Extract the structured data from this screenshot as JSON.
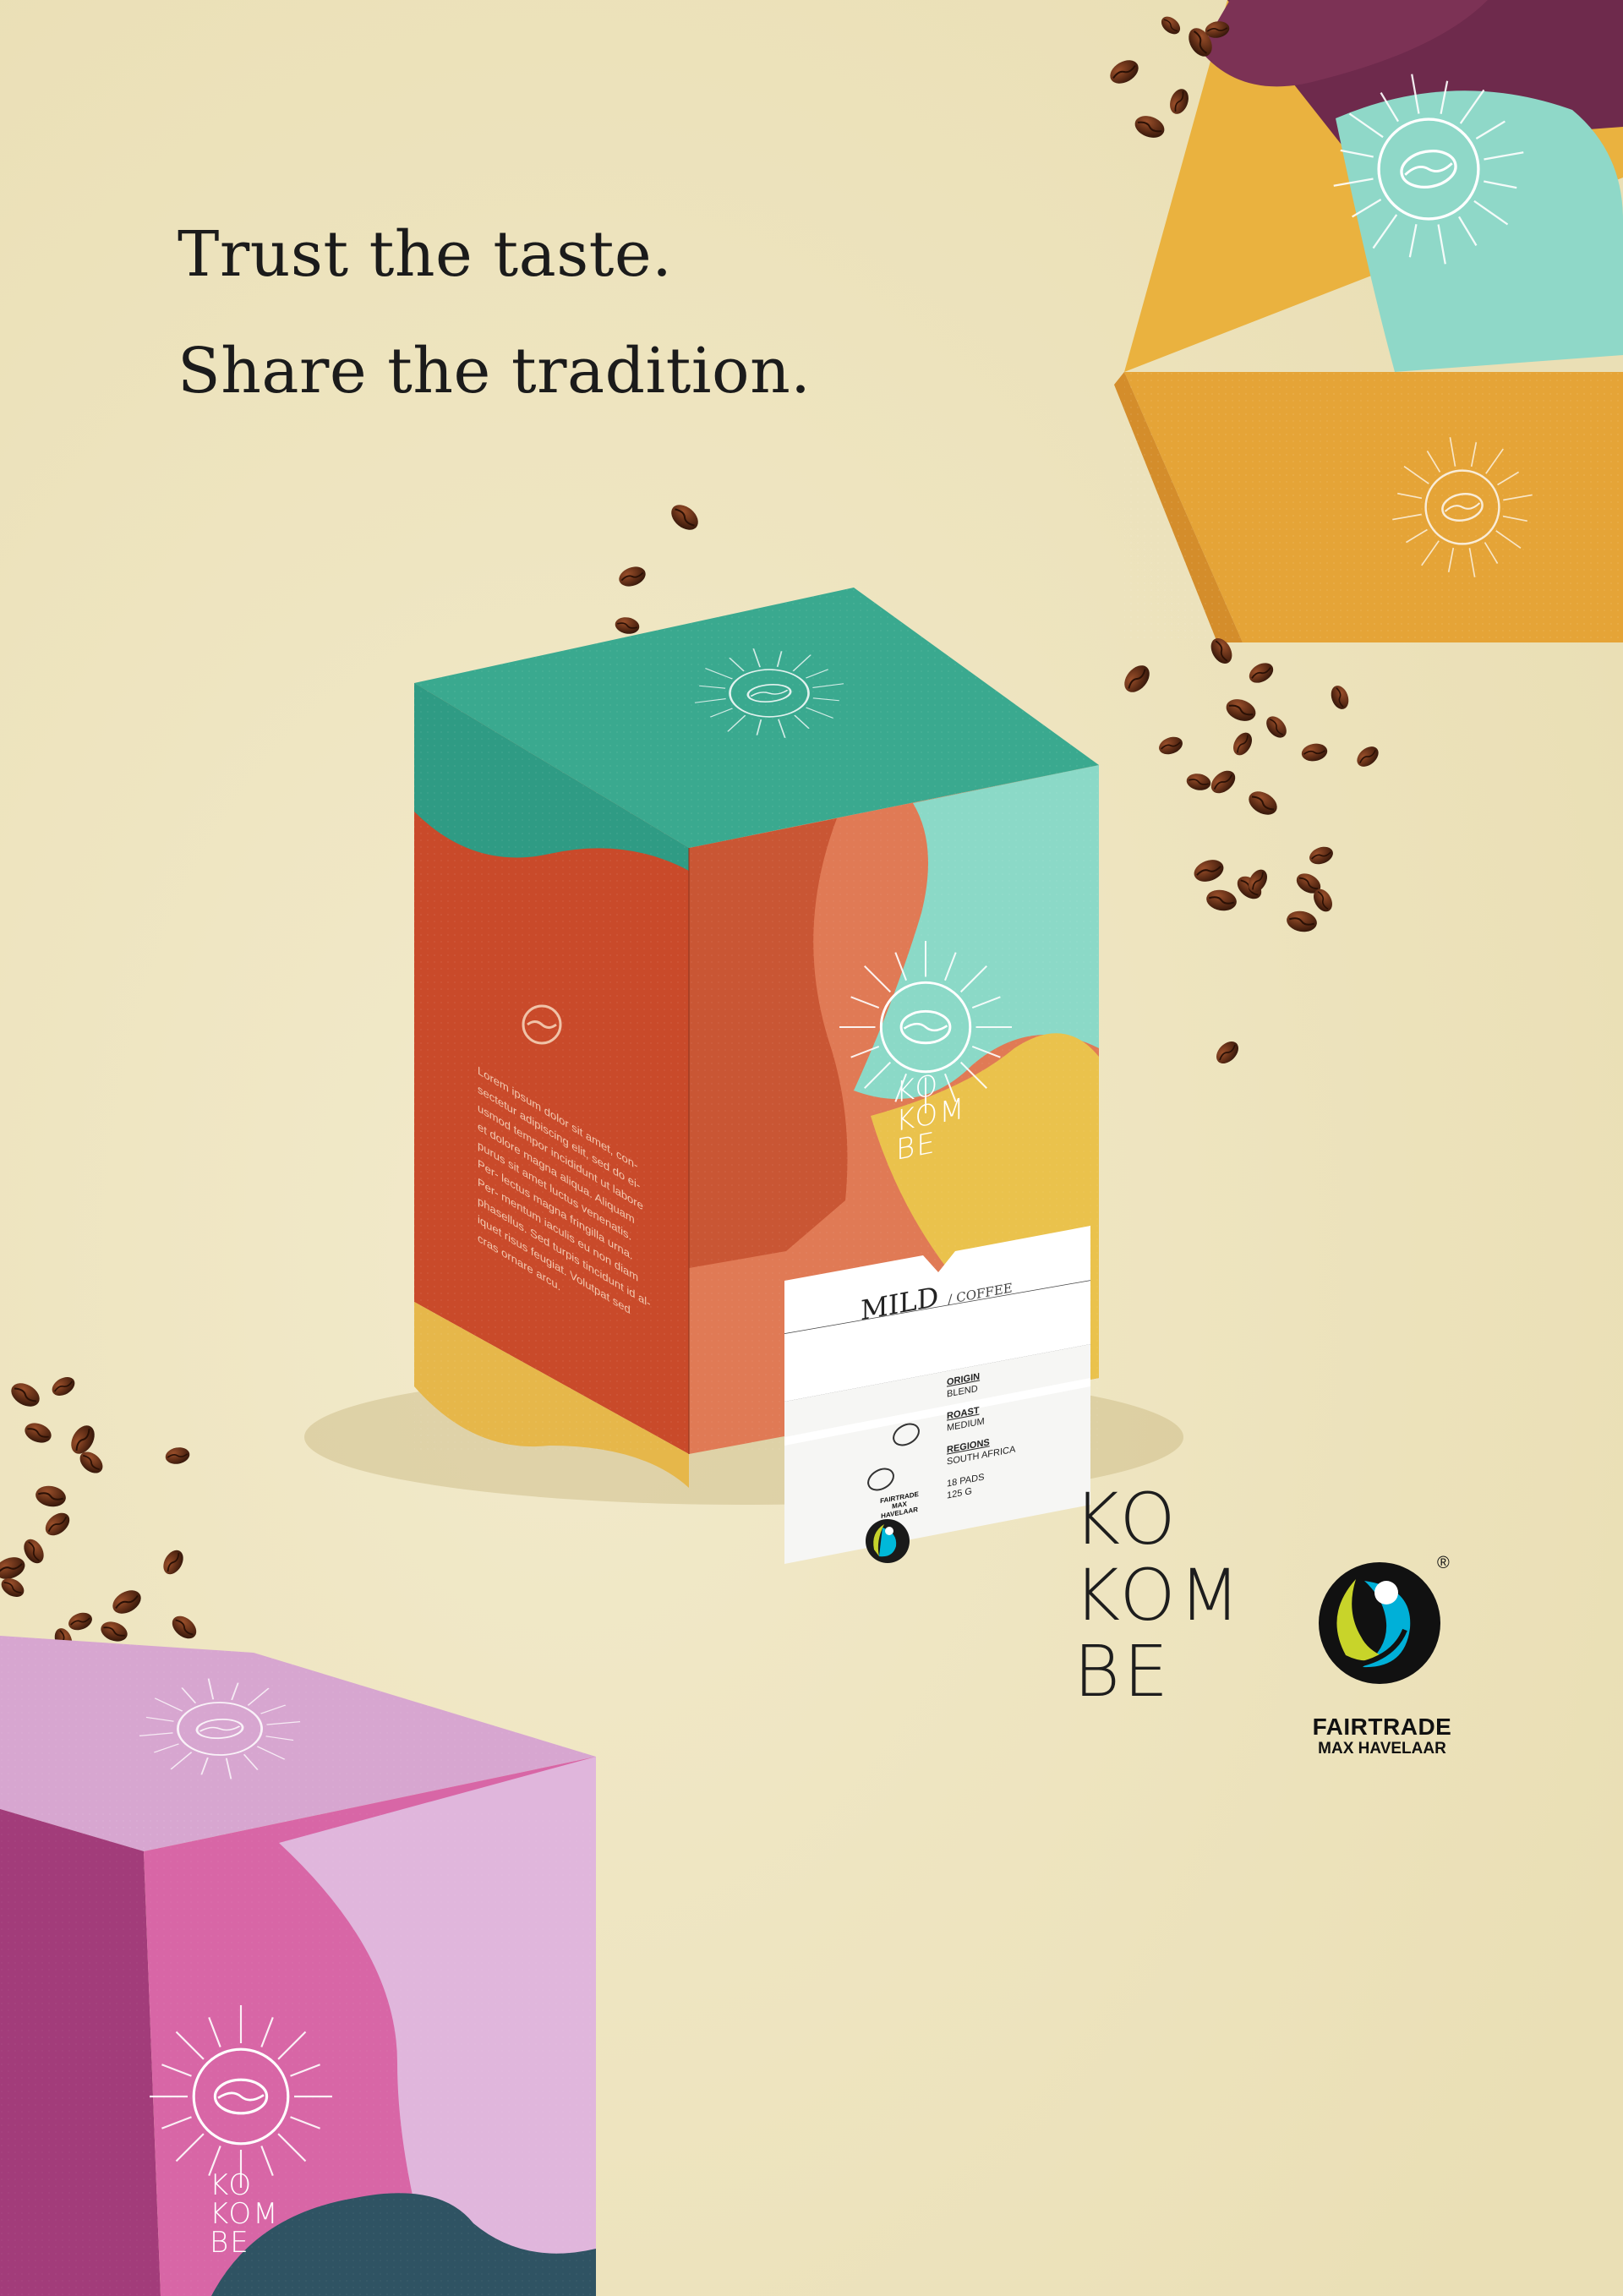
{
  "headline": {
    "line1": "Trust the taste.",
    "line2": "Share the tradition."
  },
  "box_logo": {
    "line1": "KO",
    "line2": "KOM",
    "line3": "BE"
  },
  "side_panel_text": [
    "Lorem ipsum dolor sit amet, con-",
    "sectetur adipiscing elit, sed do ei-",
    "usmod tempor incididunt ut labore",
    "et dolore magna aliqua. Aliquam",
    "purus sit amet luctus venenatis.",
    "Per- lectus magna fringilla urna.",
    "Per- mentum iaculis eu non diam",
    "phasellus. Sed turpis tincidunt id al-",
    "iquet risus feugiat. Volutpat sed",
    "cras ornare arcu."
  ],
  "label": {
    "product": "MILD",
    "category": "/ COFFEE",
    "origin_heading": "ORIGIN",
    "origin_value": "BLEND",
    "roast_heading": "ROAST",
    "roast_value": "MEDIUM",
    "regions_heading": "REGIONS",
    "regions_value": "SOUTH AFRICA",
    "pads": "18 PADS",
    "weight": "125 G",
    "fairtrade_line1": "FAIRTRADE",
    "fairtrade_line2": "MAX HAVELAAR"
  },
  "brand": {
    "line1": "KO",
    "line2": "KOM",
    "line3": "BE"
  },
  "fairtrade": {
    "line1": "FAIRTRADE",
    "line2": "MAX HAVELAAR",
    "registered": "®"
  },
  "colors": {
    "background": "#efe6c2",
    "teal": "#3aa98f",
    "mint": "#82d9c6",
    "orange": "#c9532e",
    "salmon": "#e07a55",
    "yellow": "#ecc24c",
    "purple": "#7a2f52",
    "pink": "#d866a6",
    "lilac": "#dcb3d8",
    "navy": "#2f5363",
    "bean": "#5a2a14"
  }
}
